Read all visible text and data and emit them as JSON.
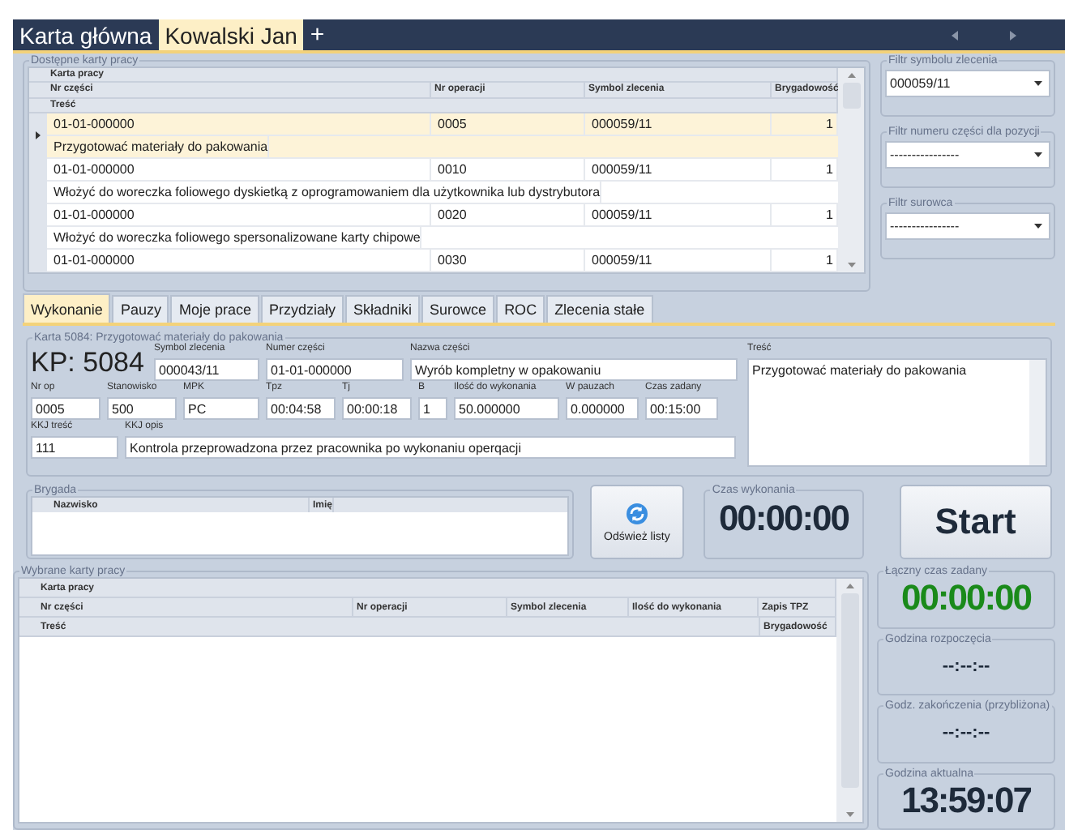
{
  "header_tabs": [
    {
      "label": "Karta główna",
      "selected": false
    },
    {
      "label": "Kowalski Jan",
      "selected": true
    }
  ],
  "add_tab": "+",
  "available": {
    "title": "Dostępne karty pracy",
    "band": "Karta pracy",
    "columns": [
      "Nr części",
      "Nr operacji",
      "Symbol zlecenia",
      "Brygadowość"
    ],
    "desc_column": "Treść",
    "rows": [
      {
        "part": "01-01-000000",
        "op": "0005",
        "symbol": "000059/11",
        "brig": "1",
        "desc": "Przygotować materiały do pakowania",
        "selected": true
      },
      {
        "part": "01-01-000000",
        "op": "0010",
        "symbol": "000059/11",
        "brig": "1",
        "desc": "Włożyć do woreczka foliowego dyskietką z oprogramowaniem dla użytkownika lub dystrybutora",
        "selected": false
      },
      {
        "part": "01-01-000000",
        "op": "0020",
        "symbol": "000059/11",
        "brig": "1",
        "desc": "Włożyć do woreczka foliowego spersonalizowane karty chipowe",
        "selected": false
      },
      {
        "part": "01-01-000000",
        "op": "0030",
        "symbol": "000059/11",
        "brig": "1",
        "selected": false
      }
    ]
  },
  "filters": [
    {
      "label": "Filtr symbolu zlecenia",
      "value": "000059/11"
    },
    {
      "label": "Filtr numeru części dla pozycji",
      "value": "----------------"
    },
    {
      "label": "Filtr surowca",
      "value": "----------------"
    }
  ],
  "detail_tabs": [
    {
      "label": "Wykonanie",
      "selected": true
    },
    {
      "label": "Pauzy",
      "selected": false
    },
    {
      "label": "Moje prace",
      "selected": false
    },
    {
      "label": "Przydziały",
      "selected": false
    },
    {
      "label": "Składniki",
      "selected": false
    },
    {
      "label": "Surowce",
      "selected": false
    },
    {
      "label": "ROC",
      "selected": false
    },
    {
      "label": "Zlecenia stałe",
      "selected": false
    }
  ],
  "card": {
    "title": "Karta 5084: Przygotować materiały do pakowania",
    "kp": "KP: 5084",
    "row1": [
      {
        "label": "Symbol zlecenia",
        "value": "000043/11"
      },
      {
        "label": "Numer części",
        "value": "01-01-000000"
      },
      {
        "label": "Nazwa części",
        "value": "Wyrób kompletny w opakowaniu"
      }
    ],
    "row2": [
      {
        "label": "Nr op",
        "value": "0005"
      },
      {
        "label": "Stanowisko",
        "value": "500"
      },
      {
        "label": "MPK",
        "value": "PC"
      },
      {
        "label": "Tpz",
        "value": "00:04:58"
      },
      {
        "label": "Tj",
        "value": "00:00:18"
      },
      {
        "label": "B",
        "value": "1"
      },
      {
        "label": "Ilość do wykonania",
        "value": "50.000000"
      },
      {
        "label": "W pauzach",
        "value": "0.000000"
      },
      {
        "label": "Czas zadany",
        "value": "00:15:00"
      }
    ],
    "row3": [
      {
        "label": "KKJ treść",
        "value": "111"
      },
      {
        "label": "KKJ opis",
        "value": "Kontrola przeprowadzona przez pracownika po wykonaniu operqacji"
      }
    ],
    "desc_label": "Treść",
    "desc": "Przygotować materiały do pakowania"
  },
  "brigade": {
    "title": "Brygada",
    "columns": [
      "Nazwisko",
      "Imię"
    ]
  },
  "refresh_button": "Odśwież listy",
  "exec_time": {
    "label": "Czas wykonania",
    "value": "00:00:00"
  },
  "start_button": "Start",
  "selected_cards": {
    "title": "Wybrane karty pracy",
    "band": "Karta pracy",
    "columns": [
      "Nr części",
      "Nr operacji",
      "Symbol zlecenia",
      "Ilość do wykonania",
      "Zapis TPZ"
    ],
    "columns2": [
      "Treść",
      "Brygadowość"
    ]
  },
  "clocks": [
    {
      "kind": "total",
      "label": "Łączny czas zadany",
      "value": "00:00:00"
    },
    {
      "kind": "pending",
      "label": "Godzina rozpoczęcia",
      "value": "--:--:--"
    },
    {
      "kind": "pending",
      "label": "Godz. zakończenia (przybliżona)",
      "value": "--:--:--"
    },
    {
      "kind": "current",
      "label": "Godzina aktualna",
      "value": "13:59:07"
    }
  ]
}
